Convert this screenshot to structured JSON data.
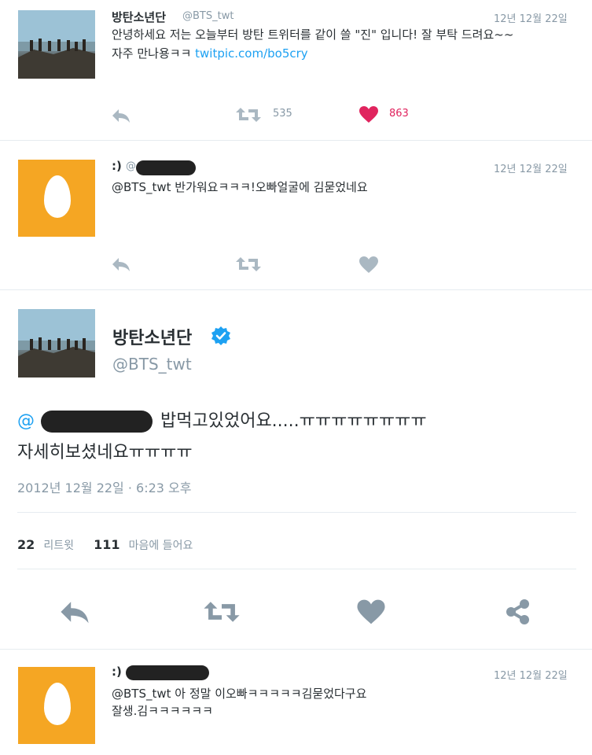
{
  "tweets": [
    {
      "name": "방탄소년단",
      "handle": "@BTS_twt",
      "date": "12년 12월 22일",
      "line1": "안녕하세요 저는 오늘부터 방탄 트위터를 같이 쓸 \"진\" 입니다! 잘 부탁 드려요~~",
      "line2_text": "자주 만나용ㅋㅋ",
      "line2_link": "twitpic.com/bo5cry",
      "retweets": "535",
      "likes": "863"
    },
    {
      "name": ":)",
      "handle": "@",
      "date": "12년 12월 22일",
      "line1": "@BTS_twt 반가워요ㅋㅋㅋ!오빠얼굴에 김묻었네요"
    },
    {
      "name": ":)",
      "date": "12년 12월 22일",
      "line1": "@BTS_twt 아 정말 이오빠ㅋㅋㅋㅋㅋ김묻었다구요",
      "line2": "잘생.김ㅋㅋㅋㅋㅋㅋ"
    }
  ],
  "detail": {
    "name": "방탄소년단",
    "handle": "@BTS_twt",
    "at": "@",
    "text1": "밥먹고있었어요.....ㅠㅠㅠㅠㅠㅠㅠㅠ",
    "text2": "자세히보셨네요ㅠㅠㅠㅠ",
    "timestamp": "2012년 12월 22일 · 6:23 오후",
    "retweet_count": "22",
    "retweet_label": "리트윗",
    "like_count": "111",
    "like_label": "마음에 들어요"
  },
  "icons": {
    "reply": "reply-icon",
    "retweet": "retweet-icon",
    "like": "heart-icon",
    "share": "share-icon",
    "verified": "verified-badge-icon"
  },
  "colors": {
    "link": "#1da1f2",
    "like_active": "#e0245e",
    "icon_gray": "#aab8c2",
    "egg_orange": "#f5a623"
  }
}
